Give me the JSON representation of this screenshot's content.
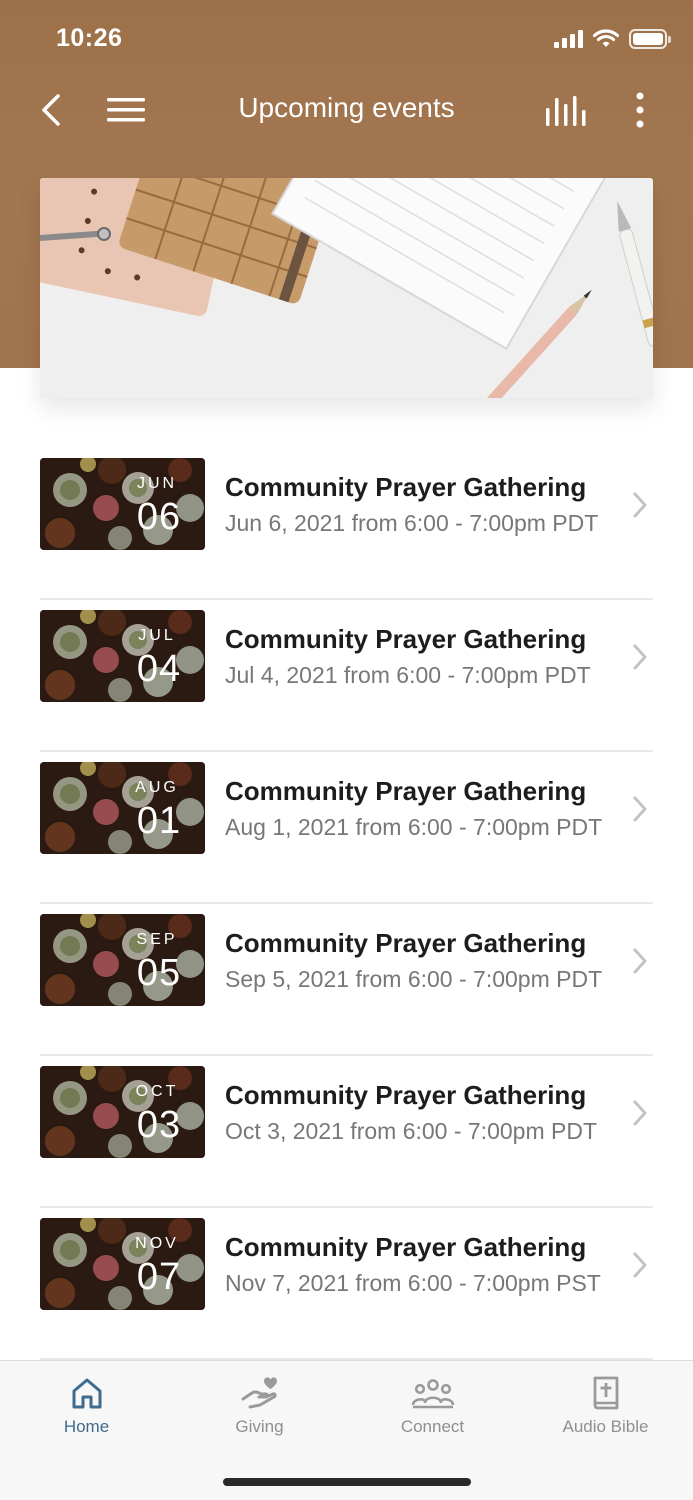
{
  "status_bar": {
    "time": "10:26"
  },
  "nav": {
    "title": "Upcoming events"
  },
  "events": [
    {
      "month": "JUN",
      "day": "06",
      "title": "Community Prayer Gathering",
      "subtitle": "Jun 6, 2021 from 6:00 - 7:00pm PDT"
    },
    {
      "month": "JUL",
      "day": "04",
      "title": "Community Prayer Gathering",
      "subtitle": "Jul 4, 2021 from 6:00 - 7:00pm PDT"
    },
    {
      "month": "AUG",
      "day": "01",
      "title": "Community Prayer Gathering",
      "subtitle": "Aug 1, 2021 from 6:00 - 7:00pm PDT"
    },
    {
      "month": "SEP",
      "day": "05",
      "title": "Community Prayer Gathering",
      "subtitle": "Sep 5, 2021 from 6:00 - 7:00pm PDT"
    },
    {
      "month": "OCT",
      "day": "03",
      "title": "Community Prayer Gathering",
      "subtitle": "Oct 3, 2021 from 6:00 - 7:00pm PDT"
    },
    {
      "month": "NOV",
      "day": "07",
      "title": "Community Prayer Gathering",
      "subtitle": "Nov 7, 2021 from 6:00 - 7:00pm PST"
    }
  ],
  "tabs": [
    {
      "label": "Home",
      "icon": "home-icon",
      "active": true
    },
    {
      "label": "Giving",
      "icon": "giving-hand-heart-icon",
      "active": false
    },
    {
      "label": "Connect",
      "icon": "people-group-icon",
      "active": false
    },
    {
      "label": "Audio Bible",
      "icon": "bible-book-icon",
      "active": false
    }
  ],
  "colors": {
    "header": "#a0744d",
    "active_tab": "#3f6b8e",
    "inactive_tab": "#8f8f8f"
  }
}
